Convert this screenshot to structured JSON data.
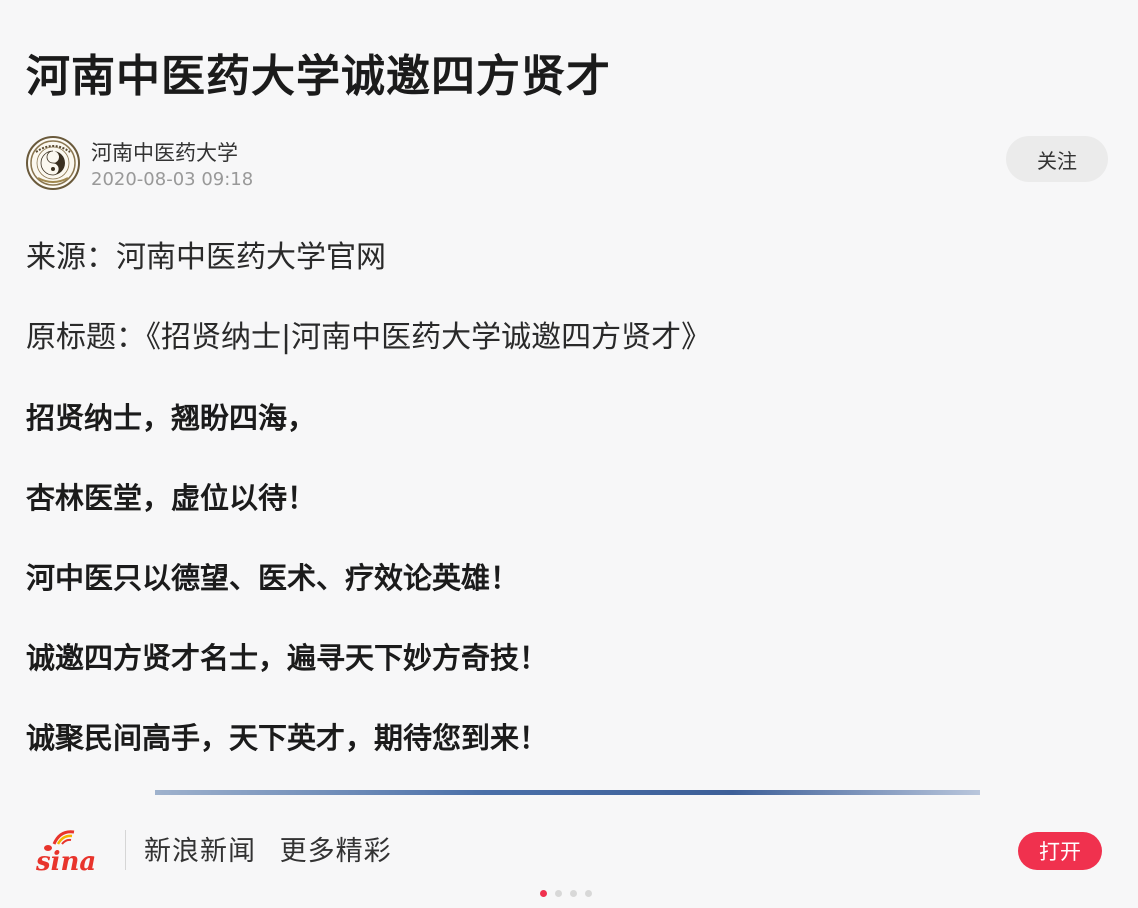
{
  "article": {
    "title": "河南中医药大学诚邀四方贤才",
    "author": "河南中医药大学",
    "publish_time": "2020-08-03 09:18",
    "follow_label": "关注",
    "paragraphs": [
      {
        "text": "来源：河南中医药大学官网",
        "bold": false
      },
      {
        "text": "原标题：《招贤纳士|河南中医药大学诚邀四方贤才》",
        "bold": false
      },
      {
        "text": "招贤纳士，翘盼四海，",
        "bold": true
      },
      {
        "text": "杏林医堂，虚位以待！",
        "bold": true
      },
      {
        "text": "河中医只以德望、医术、疗效论英雄！",
        "bold": true
      },
      {
        "text": "诚邀四方贤才名士，遍寻天下妙方奇技！",
        "bold": true
      },
      {
        "text": "诚聚民间高手，天下英才，期待您到来！",
        "bold": true
      }
    ]
  },
  "bottom_bar": {
    "logo": "sina",
    "logo_icon": "sina-eye-icon",
    "app_name": "新浪新闻",
    "slogan": "更多精彩",
    "open_label": "打开",
    "accent_color": "#f0314e"
  },
  "pager": {
    "count": 4,
    "active_index": 0
  }
}
